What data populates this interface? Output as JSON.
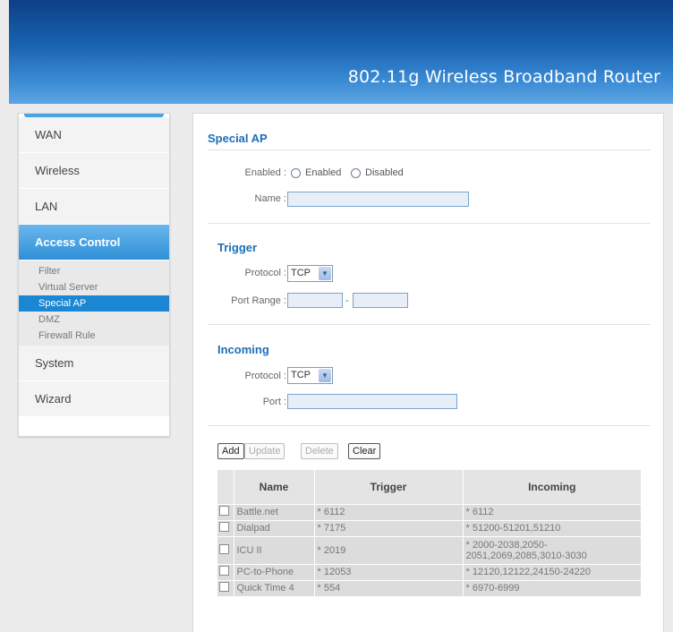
{
  "header": {
    "title": "802.11g Wireless Broadband Router"
  },
  "sidebar": {
    "items": [
      {
        "label": "WAN"
      },
      {
        "label": "Wireless"
      },
      {
        "label": "LAN"
      },
      {
        "label": "Access Control"
      },
      {
        "label": "System"
      },
      {
        "label": "Wizard"
      }
    ],
    "submenu": [
      "Filter",
      "Virtual Server",
      "Special AP",
      "DMZ",
      "Firewall Rule"
    ]
  },
  "form": {
    "title": "Special AP",
    "enabled_label": "Enabled :",
    "enabled_option": "Enabled",
    "disabled_option": "Disabled",
    "name_label": "Name :",
    "name_value": "",
    "trigger": {
      "title": "Trigger",
      "protocol_label": "Protocol :",
      "protocol_value": "TCP",
      "port_range_label": "Port Range :",
      "dash": "-",
      "port_from": "",
      "port_to": ""
    },
    "incoming": {
      "title": "Incoming",
      "protocol_label": "Protocol :",
      "protocol_value": "TCP",
      "port_label": "Port :",
      "port_value": ""
    }
  },
  "buttons": {
    "add": "Add",
    "update": "Update",
    "delete": "Delete",
    "clear": "Clear"
  },
  "table": {
    "headers": [
      "Name",
      "Trigger",
      "Incoming"
    ],
    "rows": [
      {
        "name": "Battle.net",
        "trigger": "* 6112",
        "incoming": "* 6112"
      },
      {
        "name": "Dialpad",
        "trigger": "* 7175",
        "incoming": "* 51200-51201,51210"
      },
      {
        "name": "ICU II",
        "trigger": "* 2019",
        "incoming": "* 2000-2038,2050-2051,2069,2085,3010-3030"
      },
      {
        "name": "PC-to-Phone",
        "trigger": "* 12053",
        "incoming": "* 12120,12122,24150-24220"
      },
      {
        "name": "Quick Time 4",
        "trigger": "* 554",
        "incoming": "* 6970-6999"
      }
    ]
  }
}
